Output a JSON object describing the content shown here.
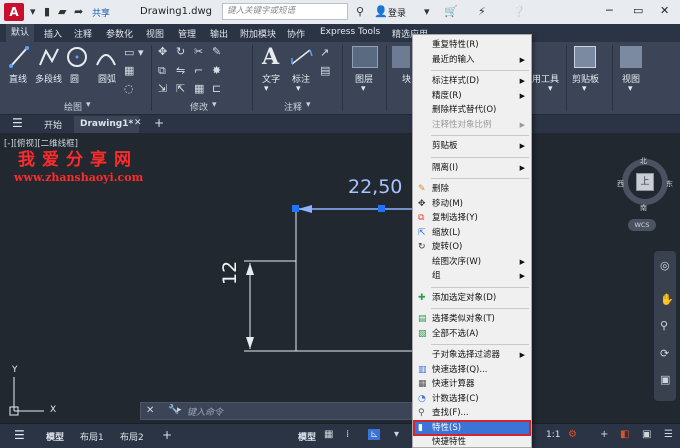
{
  "titlebar": {
    "logo": "A",
    "share": "共享",
    "doc_title": "Drawing1.dwg",
    "search_placeholder": "键入关键字或短语",
    "login": "登录"
  },
  "ribbon_tabs": [
    "默认",
    "插入",
    "注释",
    "参数化",
    "视图",
    "管理",
    "输出",
    "附加模块",
    "协作",
    "Express Tools",
    "精选应用"
  ],
  "ribbon": {
    "draw_tools": [
      "直线",
      "多段线",
      "圆",
      "圆弧"
    ],
    "draw_group": "绘图",
    "modify_group": "修改",
    "text": "文字",
    "dimension": "标注",
    "annotation_group": "注释",
    "layer": "图层",
    "block_partial": "块",
    "utilities_partial": "用工具",
    "clipboard": "剪贴板",
    "view": "视图"
  },
  "doc_tabs": {
    "start": "开始",
    "drawing": "Drawing1*"
  },
  "canvas": {
    "view_label": "[-][俯视][二维线框]",
    "watermark_cn": "我爱分享网",
    "watermark_url": "www.zhanshaoyi.com",
    "dim_horizontal": "22,50",
    "dim_vertical": "12",
    "compass": {
      "north": "北",
      "south": "南",
      "east": "东",
      "west": "西",
      "center": "上",
      "wcs": "WCS"
    },
    "ucs_y": "Y",
    "ucs_x": "X"
  },
  "command": {
    "prompt": "键入命令"
  },
  "status": {
    "tabs": [
      "模型",
      "布局1",
      "布局2"
    ],
    "model": "模型",
    "scale": "1:1"
  },
  "context_menu": {
    "items": [
      {
        "label": "重复特性(R)"
      },
      {
        "label": "最近的输入",
        "submenu": true
      },
      {
        "sep": true
      },
      {
        "label": "标注样式(D)",
        "submenu": true
      },
      {
        "label": "精度(R)",
        "submenu": true
      },
      {
        "label": "删除样式替代(O)"
      },
      {
        "label": "注释性对象比例",
        "submenu": true,
        "disabled": true
      },
      {
        "sep": true
      },
      {
        "label": "剪贴板",
        "submenu": true
      },
      {
        "sep": true
      },
      {
        "label": "隔离(I)",
        "submenu": true
      },
      {
        "sep": true
      },
      {
        "label": "删除",
        "icon": "eraser-icon"
      },
      {
        "label": "移动(M)",
        "icon": "move-icon"
      },
      {
        "label": "复制选择(Y)",
        "icon": "copy-icon"
      },
      {
        "label": "缩放(L)",
        "icon": "scale-icon"
      },
      {
        "label": "旋转(O)",
        "icon": "rotate-icon"
      },
      {
        "label": "绘图次序(W)",
        "submenu": true
      },
      {
        "label": "组",
        "submenu": true
      },
      {
        "sep": true
      },
      {
        "label": "添加选定对象(D)",
        "icon": "add-selected-icon"
      },
      {
        "sep": true
      },
      {
        "label": "选择类似对象(T)",
        "icon": "select-similar-icon"
      },
      {
        "label": "全部不选(A)",
        "icon": "deselect-all-icon"
      },
      {
        "sep": true
      },
      {
        "label": "子对象选择过滤器",
        "submenu": true
      },
      {
        "label": "快速选择(Q)...",
        "icon": "quick-select-icon"
      },
      {
        "label": "快速计算器",
        "icon": "calculator-icon"
      },
      {
        "label": "计数选择(C)",
        "icon": "count-icon"
      },
      {
        "label": "查找(F)...",
        "icon": "find-icon"
      },
      {
        "label": "特性(S)",
        "icon": "properties-icon",
        "selected": true
      },
      {
        "label": "快捷特性"
      }
    ]
  }
}
